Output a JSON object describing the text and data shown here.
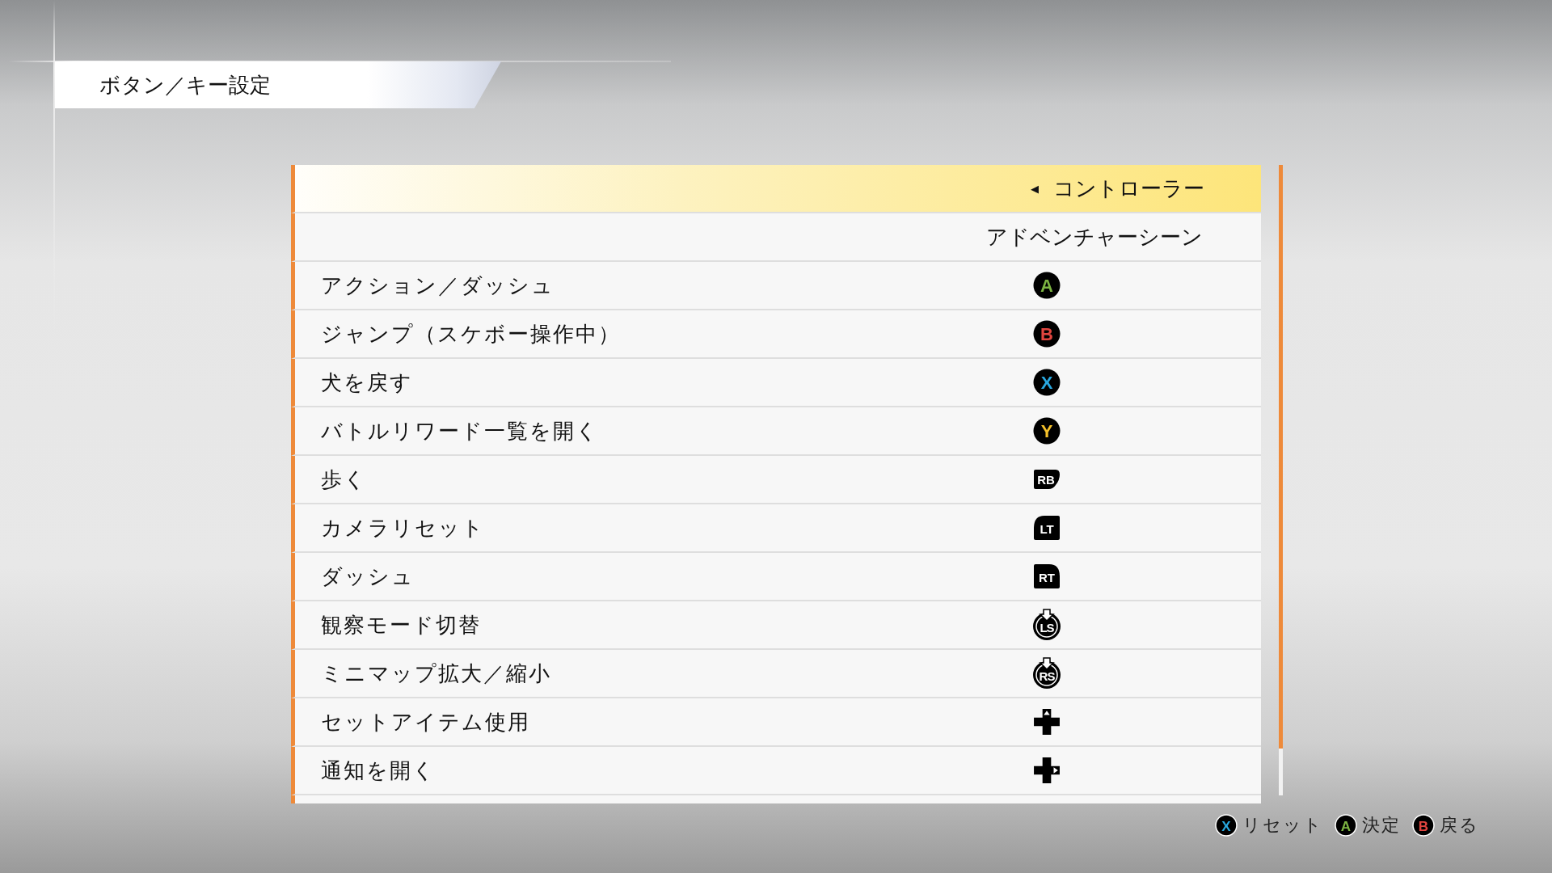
{
  "title": "ボタン／キー設定",
  "device_selector": {
    "label": "コントローラー",
    "arrow": "◀"
  },
  "column_header": "アドベンチャーシーン",
  "rows": [
    {
      "action": "アクション／ダッシュ",
      "button": {
        "kind": "face",
        "label": "A",
        "color": "#7cb342"
      }
    },
    {
      "action": "ジャンプ（スケボー操作中）",
      "button": {
        "kind": "face",
        "label": "B",
        "color": "#e0453f"
      }
    },
    {
      "action": "犬を戻す",
      "button": {
        "kind": "face",
        "label": "X",
        "color": "#29a8e0"
      }
    },
    {
      "action": "バトルリワード一覧を開く",
      "button": {
        "kind": "face",
        "label": "Y",
        "color": "#f5c12a"
      }
    },
    {
      "action": "歩く",
      "button": {
        "kind": "bumper",
        "label": "RB"
      }
    },
    {
      "action": "カメラリセット",
      "button": {
        "kind": "trigger_left",
        "label": "LT"
      }
    },
    {
      "action": "ダッシュ",
      "button": {
        "kind": "trigger_right",
        "label": "RT"
      }
    },
    {
      "action": "観察モード切替",
      "button": {
        "kind": "stick",
        "label": "LS"
      }
    },
    {
      "action": "ミニマップ拡大／縮小",
      "button": {
        "kind": "stick",
        "label": "RS"
      }
    },
    {
      "action": "セットアイテム使用",
      "button": {
        "kind": "dpad_up"
      }
    },
    {
      "action": "通知を開く",
      "button": {
        "kind": "dpad_right"
      }
    }
  ],
  "hints": [
    {
      "button": "X",
      "color": "#29a8e0",
      "label": "リセット"
    },
    {
      "button": "A",
      "color": "#7cb342",
      "label": "決定"
    },
    {
      "button": "B",
      "color": "#e0453f",
      "label": "戻る"
    }
  ]
}
